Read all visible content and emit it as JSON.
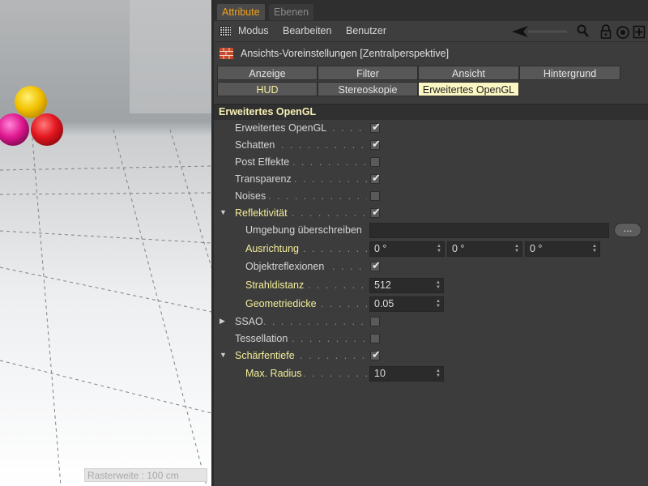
{
  "viewport": {
    "raster_label": "Rasterweite : 100 cm"
  },
  "tabs": [
    "Attribute",
    "Ebenen"
  ],
  "menu": {
    "items": [
      "Modus",
      "Bearbeiten",
      "Benutzer"
    ],
    "icons": [
      "grid-icon",
      "back-arrow-icon",
      "search-icon",
      "lock-icon",
      "target-icon",
      "new-panel-icon"
    ]
  },
  "object": {
    "title": "Ansichts-Voreinstellungen [Zentralperspektive]",
    "icon": "brick-wall-icon"
  },
  "buttons": {
    "row1": [
      "Anzeige",
      "Filter",
      "Ansicht",
      "Hintergrund"
    ],
    "row2": [
      "HUD",
      "Stereoskopie",
      "Erweitertes OpenGL"
    ],
    "selected": "Erweitertes OpenGL"
  },
  "section": {
    "title": "Erweitertes OpenGL"
  },
  "rows": [
    {
      "label": "Erweitertes OpenGL",
      "dots": " . . . . . .",
      "checked": true
    },
    {
      "label": "Schatten",
      "dots": " . . . . . . . . . . . . . .",
      "checked": true
    },
    {
      "label": "Post Effekte",
      "dots": " . . . . . . . . . . .",
      "checked": false
    },
    {
      "label": "Transparenz",
      "dots": " . . . . . . . . . . . .",
      "checked": true
    },
    {
      "label": "Noises",
      "dots": " . . . . . . . . . . . . . . . .",
      "checked": false
    },
    {
      "label": "Reflektivität",
      "dots": " . . . . . . . . . . .",
      "checked": true
    },
    {
      "label": "Umgebung überschreiben",
      "value": ""
    },
    {
      "label": "Ausrichtung",
      "dots": " . . . . . . . . . .",
      "values": [
        "0 °",
        "0 °",
        "0 °"
      ]
    },
    {
      "label": "Objektreflexionen",
      "dots": " . . . . . .",
      "checked": true
    },
    {
      "label": "Strahldistanz",
      "dots": " . . . . . . . . . .",
      "value": "512"
    },
    {
      "label": "Geometriedicke",
      "dots": " . . . . . . . . .",
      "value": "0.05"
    },
    {
      "label": "SSAO",
      "dots": " . . . . . . . . . . . . . . . . .",
      "checked": false
    },
    {
      "label": "Tessellation",
      "dots": " . . . . . . . . . . . .",
      "checked": false
    },
    {
      "label": "Schärfentiefe",
      "dots": " . . . . . . . . . . .",
      "checked": true
    },
    {
      "label": "Max. Radius",
      "dots": " . . . . . . . . . . .",
      "value": "10"
    }
  ],
  "colors": {
    "accent_tab": "#f0a21d",
    "highlight_label": "#f3ed9b",
    "selected_button": "#fbf6c2"
  }
}
